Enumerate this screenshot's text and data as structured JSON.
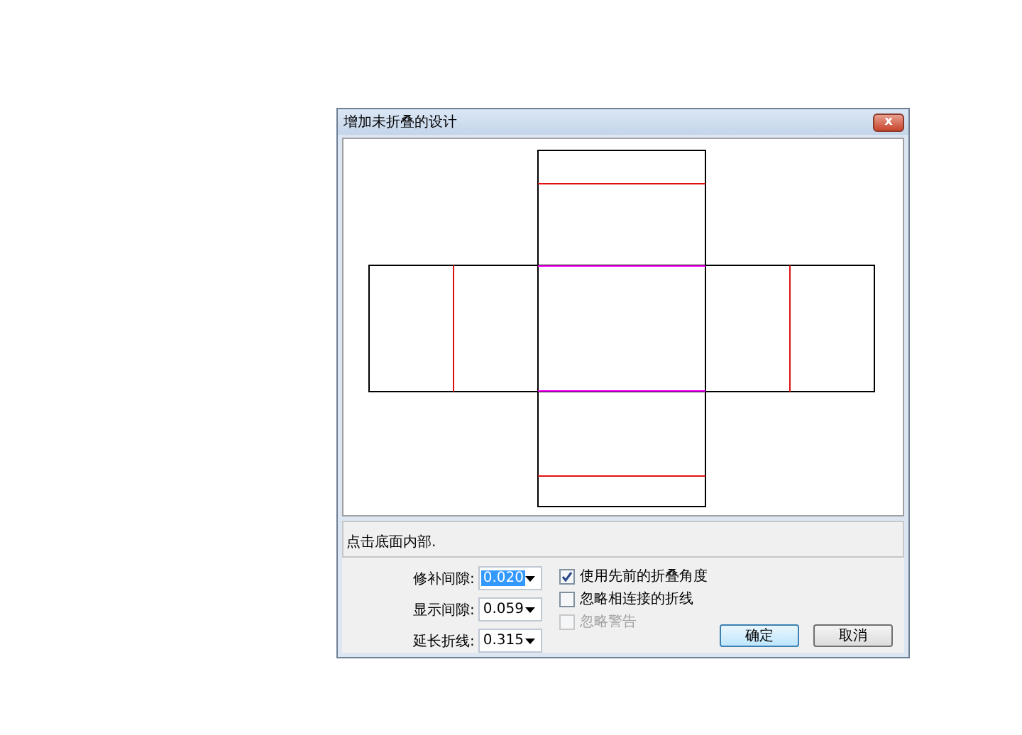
{
  "window": {
    "title": "增加未折叠的设计",
    "close_symbol": "x"
  },
  "status_text": "点击底面内部.",
  "fields": [
    {
      "label": "修补间隙:",
      "value": "0.020",
      "selected": true
    },
    {
      "label": "显示间隙:",
      "value": "0.059",
      "selected": false
    },
    {
      "label": "延长折线:",
      "value": "0.315",
      "selected": false
    }
  ],
  "checkboxes": [
    {
      "label": "使用先前的折叠角度",
      "checked": true,
      "disabled": false
    },
    {
      "label": "忽略相连接的折线",
      "checked": false,
      "disabled": false
    },
    {
      "label": "忽略警告",
      "checked": false,
      "disabled": true
    }
  ],
  "buttons": [
    {
      "label": "确定",
      "default": true
    },
    {
      "label": "取消",
      "default": false
    }
  ]
}
